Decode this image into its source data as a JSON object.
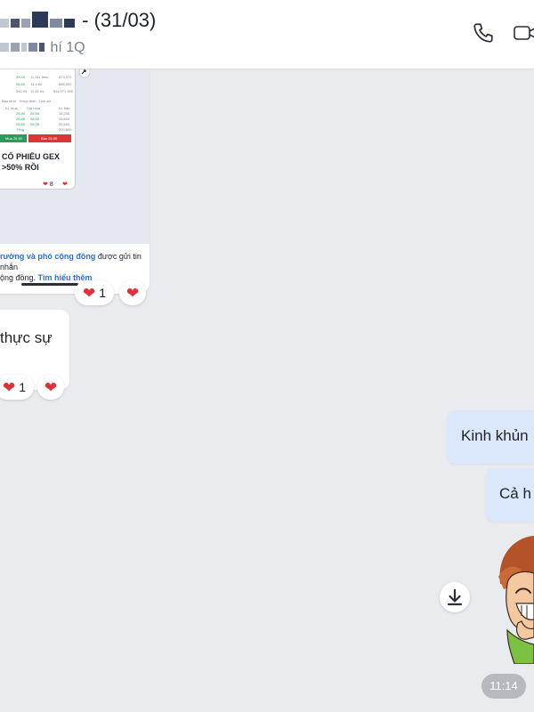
{
  "header": {
    "title_suffix": "- (31/03)",
    "subtitle": "hí 1Q",
    "icons": [
      "phone-icon",
      "video-call-icon"
    ],
    "colors": {
      "pixelation": [
        "#2b3a55",
        "#7f8aa0",
        "#c0c7d4",
        "#4a5670",
        "#9aa3b5"
      ]
    }
  },
  "chat": {
    "image_message": {
      "phone_caption": "CỔ PHIẾU GEX\n>50% RỒI",
      "phone_mini_reaction_count": "8",
      "disclaimer_link1": "rường và phó cộng đồng",
      "disclaimer_text1": " được gửi tin nhắn",
      "disclaimer_text2": "ộng đồng. ",
      "disclaimer_link2": "Tìm hiểu thêm",
      "reaction_count": "1"
    },
    "text_message_in": {
      "text": "thực sự",
      "reaction_count": "1"
    },
    "outgoing": [
      {
        "text": "Kinh khủn"
      },
      {
        "text": "Cả h"
      }
    ],
    "timestamp": "11:14"
  },
  "colors": {
    "background": "#e9ebee",
    "outgoing_bubble": "#dbe8fb",
    "heart": "#e0303a",
    "link": "#2a6fd6"
  }
}
